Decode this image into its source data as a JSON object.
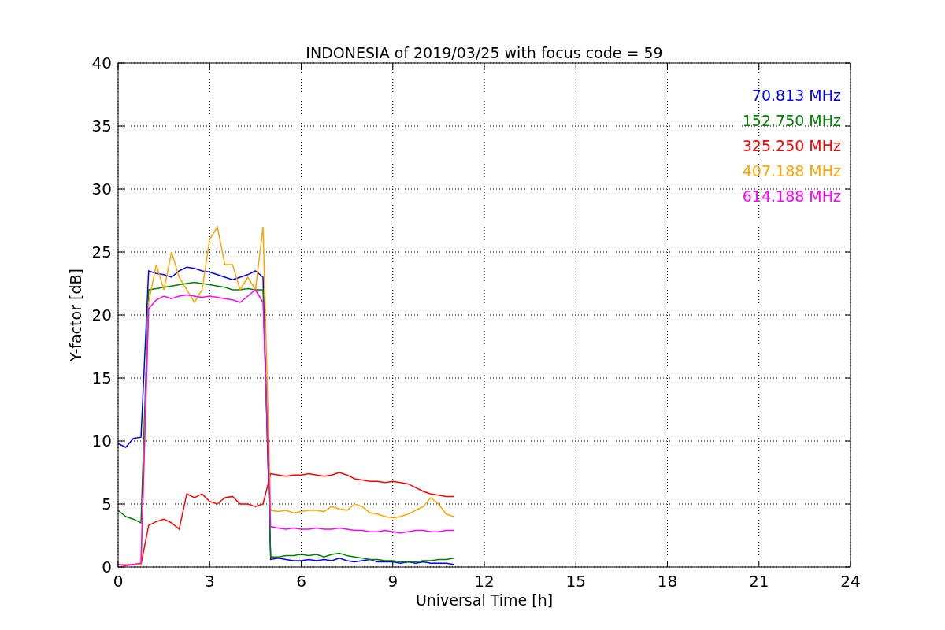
{
  "chart_data": {
    "type": "line",
    "grid": true,
    "title": "INDONESIA of 2019/03/25 with focus code = 59",
    "xlabel": "Universal Time [h]",
    "ylabel": "Y-factor [dB]",
    "x": [
      0,
      0.25,
      0.5,
      0.75,
      1,
      1.25,
      1.5,
      1.75,
      2,
      2.25,
      2.5,
      2.75,
      3,
      3.25,
      3.5,
      3.75,
      4,
      4.25,
      4.5,
      4.75,
      5,
      5.25,
      5.5,
      5.75,
      6,
      6.25,
      6.5,
      6.75,
      7,
      7.25,
      7.5,
      7.75,
      8,
      8.25,
      8.5,
      8.75,
      9,
      9.25,
      9.5,
      9.75,
      10,
      10.25,
      10.5,
      10.75,
      11
    ],
    "series": [
      {
        "name": "70.813 MHz",
        "color": "#0000ff",
        "values": [
          9.8,
          9.5,
          10.2,
          10.3,
          23.5,
          23.3,
          23.2,
          23.0,
          23.5,
          23.8,
          23.7,
          23.5,
          23.4,
          23.2,
          23.0,
          22.8,
          23.0,
          23.2,
          23.5,
          23.0,
          0.6,
          0.7,
          0.6,
          0.5,
          0.5,
          0.6,
          0.5,
          0.6,
          0.5,
          0.7,
          0.5,
          0.4,
          0.5,
          0.6,
          0.4,
          0.4,
          0.4,
          0.3,
          0.4,
          0.3,
          0.4,
          0.3,
          0.3,
          0.3,
          0.2
        ]
      },
      {
        "name": "152.750 MHz",
        "color": "#008000",
        "values": [
          4.5,
          4.0,
          3.8,
          3.5,
          22.0,
          22.1,
          22.2,
          22.3,
          22.4,
          22.5,
          22.6,
          22.5,
          22.4,
          22.3,
          22.2,
          22.0,
          22.0,
          22.1,
          22.0,
          22.0,
          0.8,
          0.8,
          0.9,
          0.9,
          1.0,
          0.9,
          1.0,
          0.8,
          1.0,
          1.1,
          0.9,
          0.8,
          0.7,
          0.6,
          0.6,
          0.5,
          0.5,
          0.4,
          0.4,
          0.4,
          0.5,
          0.5,
          0.6,
          0.6,
          0.7
        ]
      },
      {
        "name": "325.250 MHz",
        "color": "#ff0000",
        "values": [
          0.2,
          0.2,
          0.2,
          0.2,
          3.3,
          3.6,
          3.8,
          3.5,
          3.0,
          5.8,
          5.5,
          5.8,
          5.2,
          5.0,
          5.5,
          5.6,
          5.0,
          5.0,
          4.8,
          5.0,
          7.4,
          7.3,
          7.2,
          7.3,
          7.3,
          7.4,
          7.3,
          7.2,
          7.3,
          7.5,
          7.3,
          7.0,
          6.9,
          6.8,
          6.8,
          6.7,
          6.8,
          6.7,
          6.6,
          6.3,
          6.0,
          5.8,
          5.7,
          5.6,
          5.6
        ]
      },
      {
        "name": "407.188 MHz",
        "color": "#ffa500",
        "values": [
          0.2,
          0.2,
          0.2,
          0.2,
          21.0,
          24.0,
          22.0,
          25.0,
          23.0,
          22.0,
          21.0,
          22.0,
          26.0,
          27.0,
          24.0,
          24.0,
          22.0,
          23.0,
          22.0,
          27.0,
          4.5,
          4.4,
          4.5,
          4.3,
          4.4,
          4.5,
          4.5,
          4.4,
          4.8,
          4.6,
          4.5,
          5.0,
          4.8,
          4.3,
          4.2,
          4.0,
          3.9,
          4.0,
          4.2,
          4.5,
          4.8,
          5.5,
          5.0,
          4.2,
          4.0
        ]
      },
      {
        "name": "614.188 MHz",
        "color": "#ff00ff",
        "values": [
          0.2,
          0.1,
          0.2,
          0.3,
          20.5,
          21.2,
          21.5,
          21.3,
          21.5,
          21.6,
          21.5,
          21.4,
          21.5,
          21.4,
          21.3,
          21.2,
          21.0,
          21.5,
          22.0,
          21.0,
          3.2,
          3.1,
          3.0,
          3.1,
          3.0,
          3.0,
          3.1,
          3.0,
          3.0,
          3.1,
          3.0,
          2.9,
          2.9,
          2.8,
          2.8,
          2.9,
          2.8,
          2.7,
          2.8,
          2.9,
          2.9,
          2.8,
          2.8,
          2.9,
          2.9
        ]
      }
    ],
    "xlim": [
      0,
      24
    ],
    "ylim": [
      0,
      40
    ],
    "xticks": [
      0,
      3,
      6,
      9,
      12,
      15,
      18,
      21,
      24
    ],
    "yticks": [
      0,
      5,
      10,
      15,
      20,
      25,
      30,
      35,
      40
    ]
  }
}
